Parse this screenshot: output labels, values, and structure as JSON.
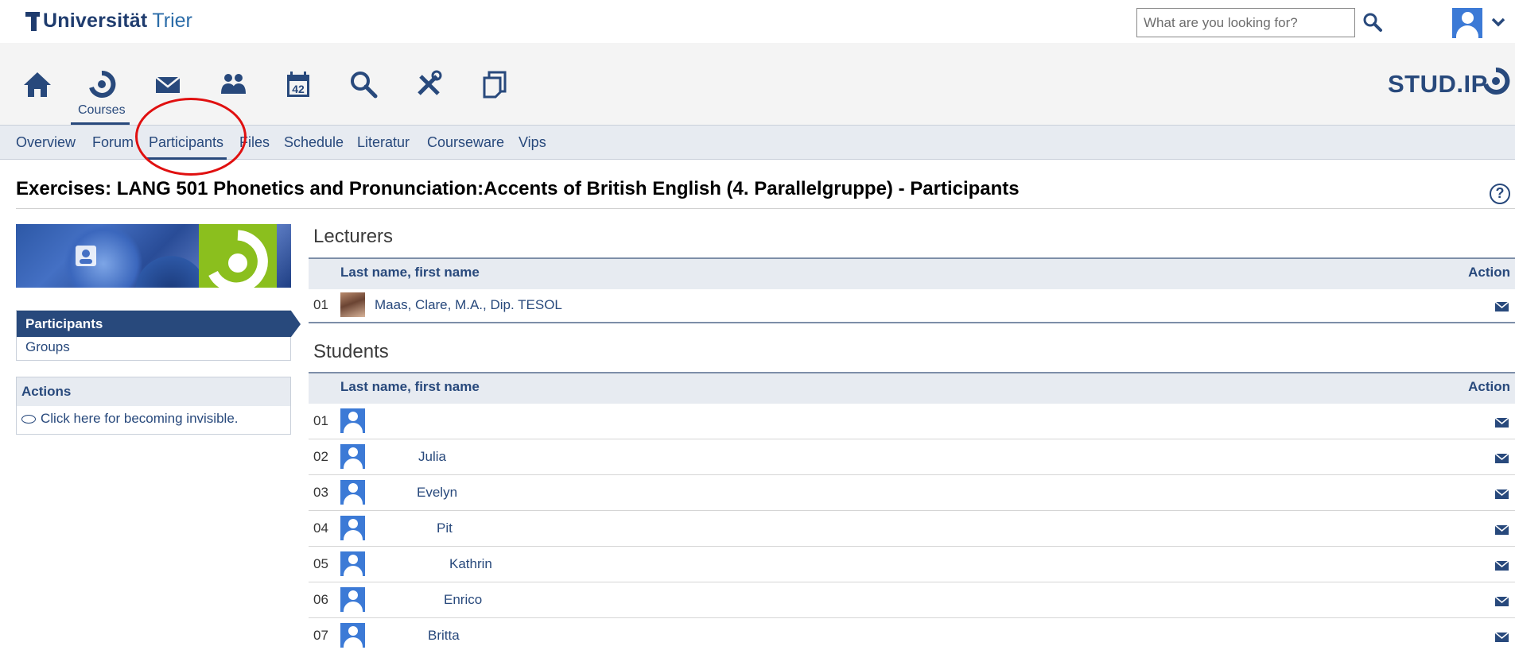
{
  "header": {
    "logo_strong": "Universität",
    "logo_light": "Trier",
    "search_placeholder": "What are you looking for?"
  },
  "nav": {
    "active_label": "Courses",
    "icons": [
      "home-icon",
      "courses-icon",
      "mail-icon",
      "community-icon",
      "calendar-icon",
      "search-icon",
      "tools-icon",
      "files-icon"
    ],
    "calendar_day": "42",
    "brand": "STUD.IP"
  },
  "tabs": [
    "Overview",
    "Forum",
    "Participants",
    "Files",
    "Schedule",
    "Literatur",
    "Courseware",
    "Vips"
  ],
  "active_tab": "Participants",
  "page_title": "Exercises: LANG 501 Phonetics and Pronunciation:Accents of British English (4. Parallelgruppe) - Participants",
  "sidebar": {
    "nav_items": [
      "Participants",
      "Groups"
    ],
    "actions_title": "Actions",
    "actions_item": "Click here for becoming invisible."
  },
  "lecturers": {
    "title": "Lecturers",
    "col_name": "Last name, first name",
    "col_action": "Action",
    "rows": [
      {
        "num": "01",
        "name": "Maas, Clare, M.A., Dip. TESOL"
      }
    ]
  },
  "students": {
    "title": "Students",
    "col_name": "Last name, first name",
    "col_action": "Action",
    "rows": [
      {
        "num": "01",
        "name": ""
      },
      {
        "num": "02",
        "name": "Julia"
      },
      {
        "num": "03",
        "name": "Evelyn"
      },
      {
        "num": "04",
        "name": "Pit"
      },
      {
        "num": "05",
        "name": "Kathrin"
      },
      {
        "num": "06",
        "name": "Enrico"
      },
      {
        "num": "07",
        "name": "Britta"
      }
    ]
  },
  "colors": {
    "brand": "#28497c",
    "highlight": "#e01010",
    "accent_green": "#8bbf1e"
  }
}
